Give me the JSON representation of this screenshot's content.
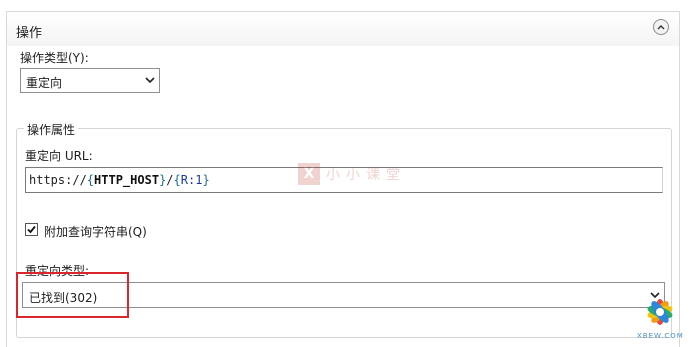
{
  "panel": {
    "title": "操作",
    "collapse_icon": "chevron-up-icon"
  },
  "action_type": {
    "label": "操作类型(Y):",
    "value": "重定向"
  },
  "action_properties": {
    "legend": "操作属性",
    "redirect_url_label": "重定向 URL:",
    "redirect_url_parts": {
      "prefix": "https://",
      "open1": "{",
      "var1": "HTTP_HOST",
      "close1": "}",
      "slash": "/",
      "open2": "{",
      "var2": "R:1",
      "close2": "}"
    },
    "append_query_label": "附加查询字符串(Q)",
    "append_query_checked": true,
    "redirect_type_label": "重定向类型:",
    "redirect_type_value": "已找到(302)"
  },
  "watermark": {
    "text": "小小课堂",
    "logo_letter": "X"
  },
  "corner_logo": {
    "caption": "XBEW.COM"
  },
  "colors": {
    "highlight": "#d9252c",
    "accent": "#1a6f8a"
  }
}
